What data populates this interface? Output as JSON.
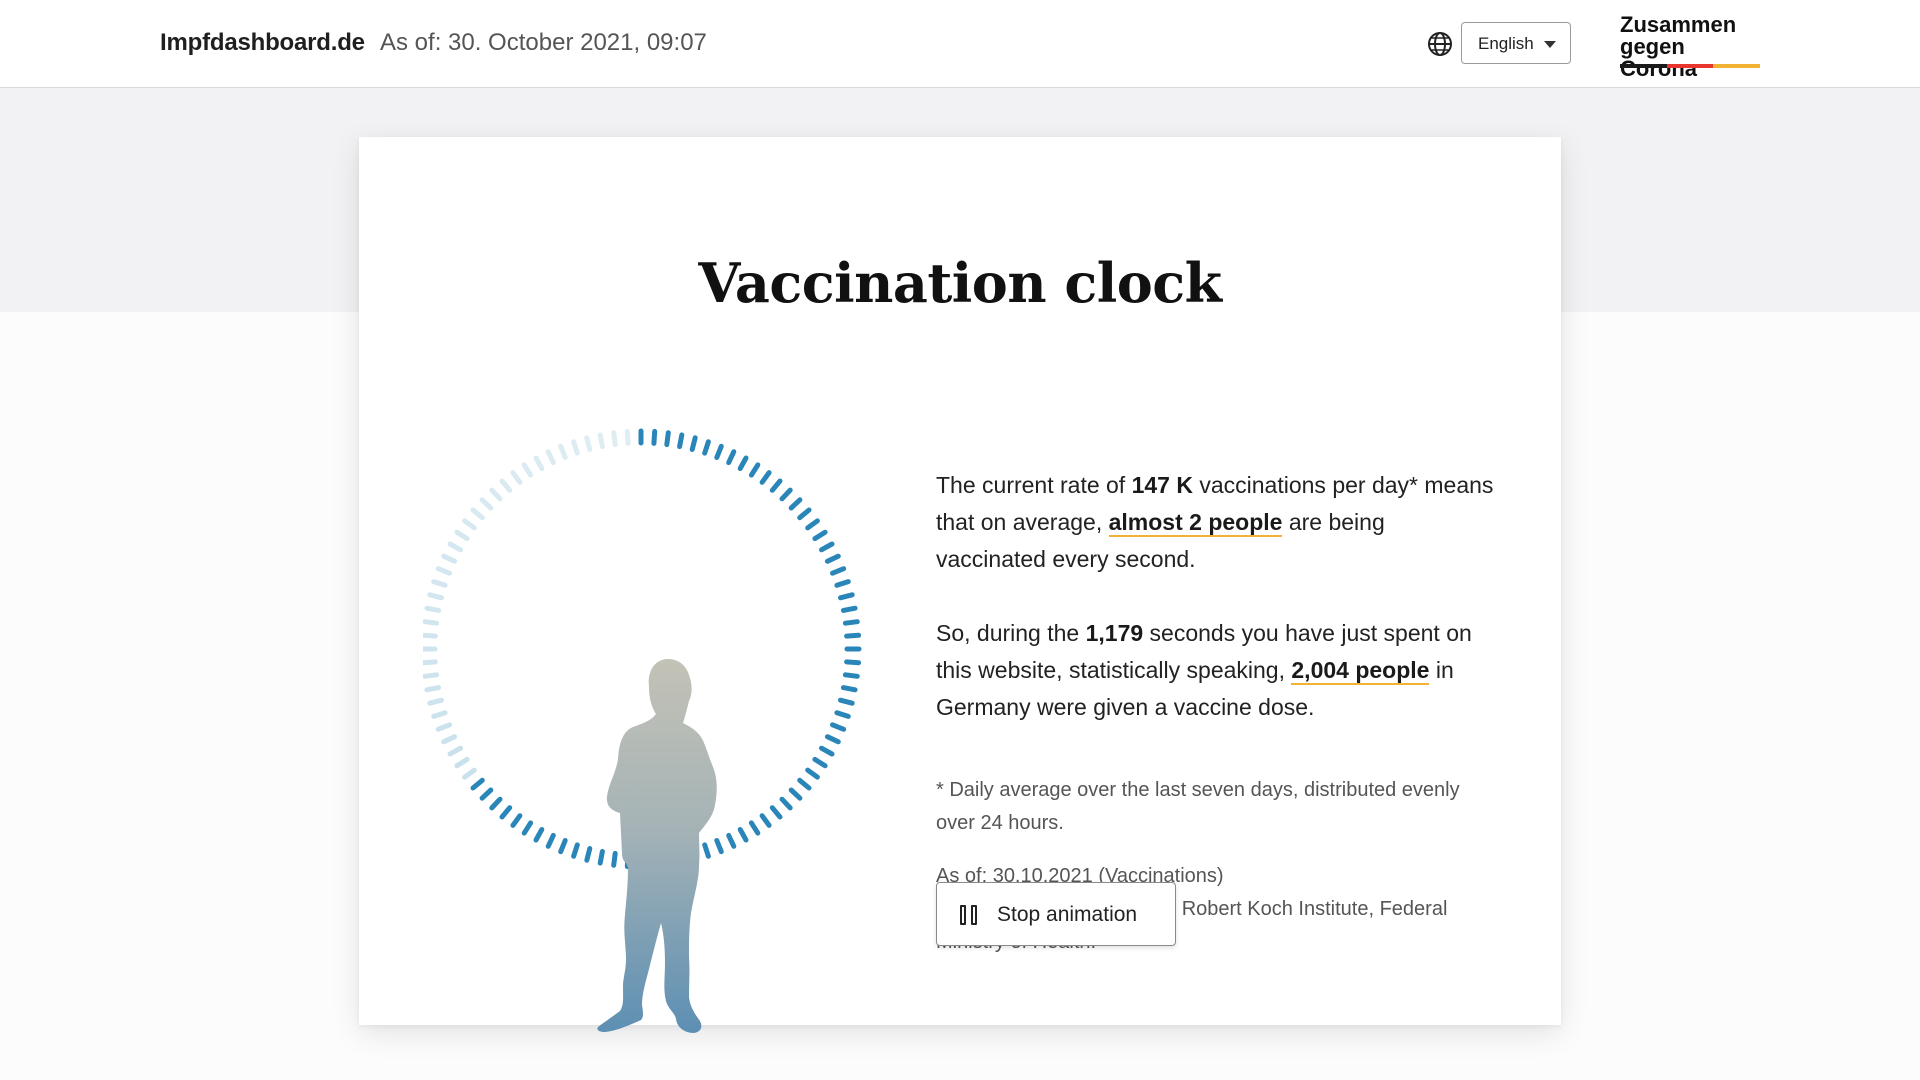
{
  "header": {
    "brand": "Impfdashboard.de",
    "as_of": "As of: 30. October 2021, 09:07",
    "language": {
      "selected": "English",
      "icon": "globe-icon"
    },
    "logo": {
      "line1": "Zusammen",
      "line2": "gegen Corona",
      "colors": [
        "#1a1a1a",
        "#e8352e",
        "#f2b233"
      ]
    }
  },
  "main": {
    "title": "Vaccination clock",
    "rate": {
      "intro": "The current rate of ",
      "value": "147 K",
      "after_value": " vaccinations per day* means that on average, ",
      "highlight": "almost 2 people",
      "outro": " are being vaccinated every second."
    },
    "elapsed": {
      "intro": "So, during the ",
      "seconds": "1,179",
      "after_seconds": " seconds you have just spent on this website, statistically speaking, ",
      "people": "2,004 people",
      "outro": " in Germany were given a vaccine dose."
    },
    "footnote": "* Daily average over the last seven days, distributed evenly over 24 hours.",
    "meta": {
      "as_of": "As of: 30.10.2021 (Vaccinations)",
      "source": "Source: impfdashboard.de, Robert Koch Institute, Federal Ministry of Health."
    },
    "stop_button": {
      "label": "Stop animation",
      "icon": "pause-icon"
    },
    "clock": {
      "progress": 0.65,
      "icon": "person-silhouette-icon",
      "accent_color": "#2a86b8",
      "faded_color": "#c9e1ec"
    }
  }
}
